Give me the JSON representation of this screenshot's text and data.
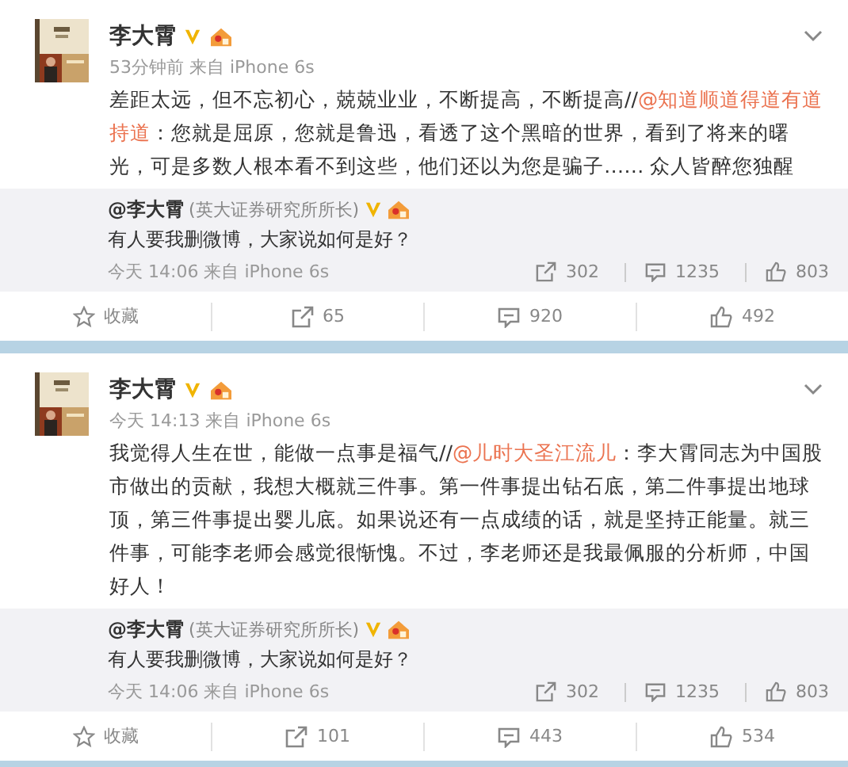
{
  "posts": [
    {
      "author": "李大霄",
      "time": "53分钟前 来自 iPhone 6s",
      "text": [
        {
          "kind": "text",
          "text": "差距太远，但不忘初心，兢兢业业，不断提高，不断提高//"
        },
        {
          "kind": "mention",
          "text": "@知道顺道得道有道持道"
        },
        {
          "kind": "text",
          "text": "：您就是屈原，您就是鲁迅，看透了这个黑暗的世界，看到了将来的曙光，可是多数人根本看不到这些，他们还以为您是骗子…… 众人皆醉您独醒"
        }
      ],
      "quote": {
        "author": "@李大霄",
        "title": "(英大证券研究所所长)",
        "text": "有人要我删微博，大家说如何是好？",
        "time": "今天 14:06 来自 iPhone 6s",
        "reposts": "302",
        "comments": "1235",
        "likes": "803"
      },
      "actions": {
        "favorite": "收藏",
        "reposts": "65",
        "comments": "920",
        "likes": "492"
      }
    },
    {
      "author": "李大霄",
      "time": "今天 14:13 来自 iPhone 6s",
      "text": [
        {
          "kind": "text",
          "text": "我觉得人生在世，能做一点事是福气//"
        },
        {
          "kind": "mention",
          "text": "@儿时大圣江流儿"
        },
        {
          "kind": "text",
          "text": "：李大霄同志为中国股市做出的贡献，我想大概就三件事。第一件事提出钻石底，第二件事提出地球顶，第三件事提出婴儿底。如果说还有一点成绩的话，就是坚持正能量。就三件事，可能李老师会感觉很惭愧。不过，李老师还是我最佩服的分析师，中国好人！"
        }
      ],
      "quote": {
        "author": "@李大霄",
        "title": "(英大证券研究所所长)",
        "text": "有人要我删微博，大家说如何是好？",
        "time": "今天 14:06 来自 iPhone 6s",
        "reposts": "302",
        "comments": "1235",
        "likes": "803"
      },
      "actions": {
        "favorite": "收藏",
        "reposts": "101",
        "comments": "443",
        "likes": "534"
      }
    }
  ]
}
